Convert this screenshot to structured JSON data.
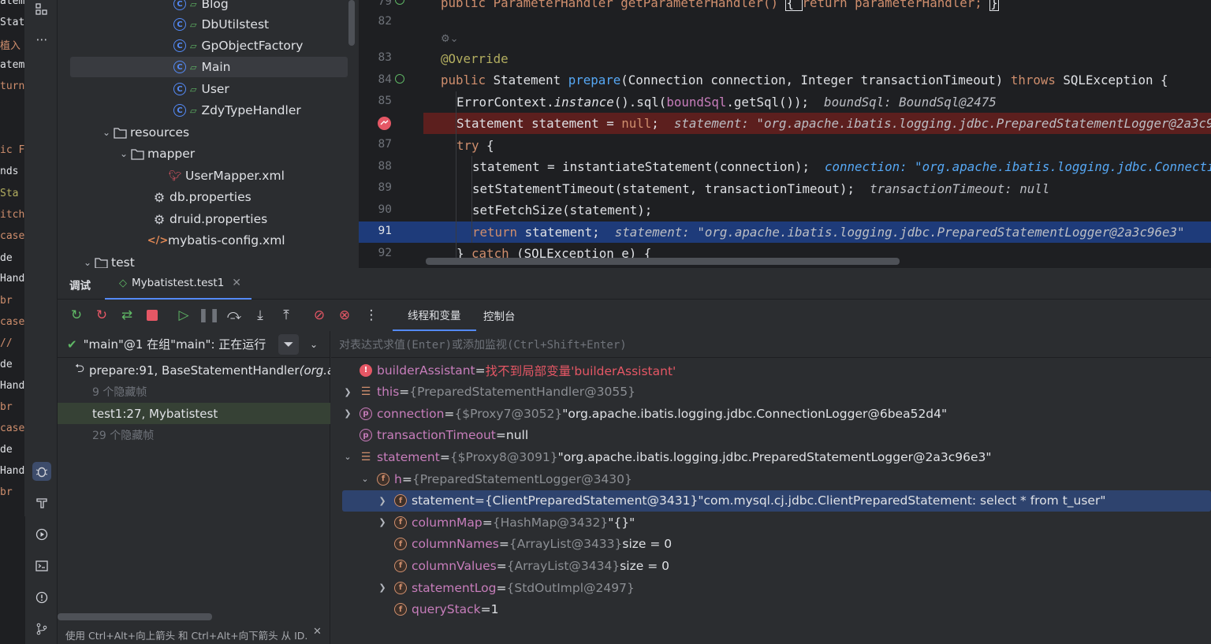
{
  "left_strip": [
    "atem",
    "Stat",
    "植入",
    "atem",
    "turn",
    "ic F",
    "nds",
    "Sta",
    "itch",
    "case",
    "de",
    "Hand",
    "br",
    "case",
    "//",
    "de",
    "Hand",
    "br",
    "case",
    "de",
    "Hand",
    "br"
  ],
  "project_tree": [
    {
      "label": "Blog",
      "type": "class"
    },
    {
      "label": "DbUtilstest",
      "type": "class"
    },
    {
      "label": "GpObjectFactory",
      "type": "class"
    },
    {
      "label": "Main",
      "type": "class",
      "selected": true
    },
    {
      "label": "User",
      "type": "class"
    },
    {
      "label": "ZdyTypeHandler",
      "type": "class"
    },
    {
      "label": "resources",
      "type": "folder"
    },
    {
      "label": "mapper",
      "type": "folder"
    },
    {
      "label": "UserMapper.xml",
      "type": "xml"
    },
    {
      "label": "db.properties",
      "type": "props"
    },
    {
      "label": "druid.properties",
      "type": "props"
    },
    {
      "label": "mybatis-config.xml",
      "type": "xmlcode"
    },
    {
      "label": "test",
      "type": "folder"
    }
  ],
  "editor": {
    "line_numbers": [
      "79",
      "82",
      "83",
      "84",
      "85",
      "",
      "87",
      "88",
      "89",
      "90",
      "91",
      "92"
    ],
    "lines": {
      "l79a": "public ParameterHandler getParameterHandler() ",
      "l79b": "{ ",
      "l79c": "return parameterHandler; ",
      "l79d": "}",
      "l83": "@Override",
      "l84_kw": "public ",
      "l84_a": "Statement ",
      "l84_fn": "prepare",
      "l84_b": "(Connection connection, Integer transactionTimeout) ",
      "l84_kw2": "throws ",
      "l84_c": "SQLException {",
      "l85_a": "ErrorContext.",
      "l85_it": "instance",
      "l85_b": "().sql(",
      "l85_fld": "boundSql",
      "l85_c": ".getSql());",
      "l85_hint": "  boundSql: BoundSql@2475",
      "l86_a": "Statement statement = ",
      "l86_kw": "null",
      "l86_b": ";",
      "l86_hint": "  statement: \"org.apache.ibatis.logging.jdbc.PreparedStatementLogger@2a3c96e3\"",
      "l87_kw": "try ",
      "l87_b": "{",
      "l88_a": "statement = instantiateStatement(connection);",
      "l88_hint": "  connection: \"org.apache.ibatis.logging.jdbc.ConnectionLogger@6bea52d4\"",
      "l89_a": "setStatementTimeout(statement, transactionTimeout);",
      "l89_hint": "  transactionTimeout: null",
      "l90_a": "setFetchSize(statement);",
      "l91_kw": "return ",
      "l91_a": "statement;",
      "l91_hint": "  statement: \"org.apache.ibatis.logging.jdbc.PreparedStatementLogger@2a3c96e3\"",
      "l92_a": "} ",
      "l92_kw": "catch ",
      "l92_b": "(SQLException e) {"
    }
  },
  "debug": {
    "tab_debug": "调试",
    "tab_session": "Mybatistest.test1",
    "tab_threads": "线程和变量",
    "tab_console": "控制台",
    "thread_label": "\"main\"@1 在组\"main\": 正在运行",
    "eval_placeholder": "对表达式求值(Enter)或添加监视(Ctrl+Shift+Enter)",
    "frames": [
      {
        "label": "prepare:91, BaseStatementHandler ",
        "extra": "(org.a",
        "kind": "current"
      },
      {
        "label": "9 个隐藏帧",
        "kind": "hidden"
      },
      {
        "label": "test1:27, Mybatistest",
        "kind": "selected"
      },
      {
        "label": "29 个隐藏帧",
        "kind": "hidden"
      }
    ],
    "hint_bar": "使用 Ctrl+Alt+向上箭头 和 Ctrl+Alt+向下箭头 从 ID.",
    "variables": [
      {
        "name": "builderAssistant",
        "eq": " = ",
        "val": "找不到局部变量'builderAssistant'",
        "kind": "err",
        "indent": 0,
        "expand": ""
      },
      {
        "name": "this",
        "eq": " = ",
        "val": "{PreparedStatementHandler@3055}",
        "kind": "list",
        "indent": 0,
        "expand": ">"
      },
      {
        "name": "connection",
        "eq": " = ",
        "val": "{$Proxy7@3052} ",
        "str": "\"org.apache.ibatis.logging.jdbc.ConnectionLogger@6bea52d4\"",
        "kind": "p",
        "indent": 0,
        "expand": ">"
      },
      {
        "name": "transactionTimeout",
        "eq": " = ",
        "str": "null",
        "kind": "p",
        "indent": 0,
        "expand": ""
      },
      {
        "name": "statement",
        "eq": " = ",
        "val": "{$Proxy8@3091} ",
        "str": "\"org.apache.ibatis.logging.jdbc.PreparedStatementLogger@2a3c96e3\"",
        "kind": "list",
        "indent": 0,
        "expand": "v"
      },
      {
        "name": "h",
        "eq": " = ",
        "val": "{PreparedStatementLogger@3430}",
        "kind": "f",
        "indent": 1,
        "expand": "v"
      },
      {
        "name": "statement",
        "eq": " = ",
        "val": "{ClientPreparedStatement@3431} ",
        "str": "\"com.mysql.cj.jdbc.ClientPreparedStatement: select * from t_user\"",
        "kind": "f",
        "indent": 2,
        "expand": ">",
        "selected": true
      },
      {
        "name": "columnMap",
        "eq": " = ",
        "val": "{HashMap@3432} ",
        "str": "\"{}\"",
        "kind": "f",
        "indent": 2,
        "expand": ">"
      },
      {
        "name": "columnNames",
        "eq": " = ",
        "val": "{ArrayList@3433} ",
        "str": " size = 0",
        "kind": "f",
        "indent": 2,
        "expand": ""
      },
      {
        "name": "columnValues",
        "eq": " = ",
        "val": "{ArrayList@3434} ",
        "str": " size = 0",
        "kind": "f",
        "indent": 2,
        "expand": ""
      },
      {
        "name": "statementLog",
        "eq": " = ",
        "val": "{StdOutImpl@2497}",
        "kind": "f",
        "indent": 2,
        "expand": ">"
      },
      {
        "name": "queryStack",
        "eq": " = ",
        "str": "1",
        "kind": "f",
        "indent": 2,
        "expand": ""
      }
    ]
  },
  "colors": {
    "accent": "#548af7",
    "selection": "#2e436e",
    "breakpoint_line": "#5c1f1e",
    "exec_line": "#1e3b7a"
  }
}
